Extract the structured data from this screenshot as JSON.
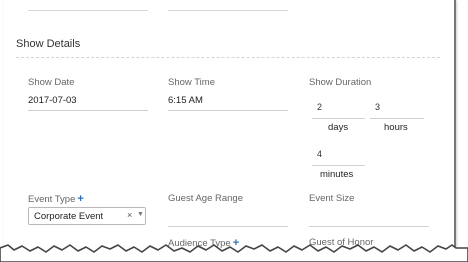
{
  "section": {
    "title": "Show Details"
  },
  "fields": {
    "show_date": {
      "label": "Show Date",
      "value": "2017-07-03"
    },
    "show_time": {
      "label": "Show Time",
      "value": "6:15 AM"
    },
    "show_duration": {
      "label": "Show Duration",
      "days": {
        "value": "2",
        "unit": "days"
      },
      "hours": {
        "value": "3",
        "unit": "hours"
      },
      "minutes": {
        "value": "4",
        "unit": "minutes"
      }
    },
    "event_type": {
      "label": "Event Type",
      "value": "Corporate Event",
      "clear": "×",
      "caret": "▼"
    },
    "guest_age_range": {
      "label": "Guest Age Range"
    },
    "event_size": {
      "label": "Event Size"
    },
    "audience_type": {
      "label": "Audience Type"
    },
    "guest_of_honor": {
      "label": "Guest of Honor"
    }
  },
  "icons": {
    "plus_color": "#2f6fb6",
    "plus": "+"
  }
}
